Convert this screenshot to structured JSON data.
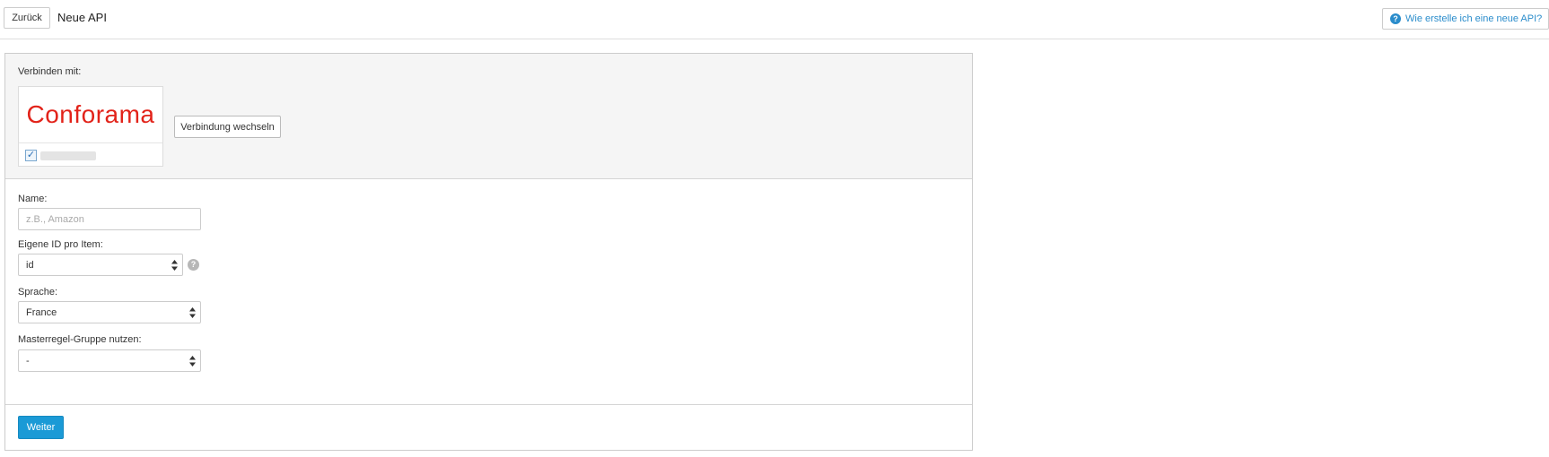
{
  "header": {
    "back_label": "Zurück",
    "title": "Neue API",
    "help_label": "Wie erstelle ich eine neue API?",
    "help_icon": "question-circle-icon"
  },
  "connect": {
    "label": "Verbinden mit:",
    "logo_text": "Conforama",
    "logo_color": "#e2231a",
    "checkbox_checked": true,
    "switch_label": "Verbindung wechseln"
  },
  "form": {
    "name": {
      "label": "Name:",
      "placeholder": "z.B., Amazon",
      "value": ""
    },
    "own_id": {
      "label": "Eigene ID pro Item:",
      "value": "id"
    },
    "language": {
      "label": "Sprache:",
      "value": "France"
    },
    "master_rule": {
      "label": "Masterregel-Gruppe nutzen:",
      "value": "-"
    }
  },
  "footer": {
    "next_label": "Weiter"
  },
  "colors": {
    "accent": "#1b9ad6",
    "link": "#2a8ccb"
  }
}
